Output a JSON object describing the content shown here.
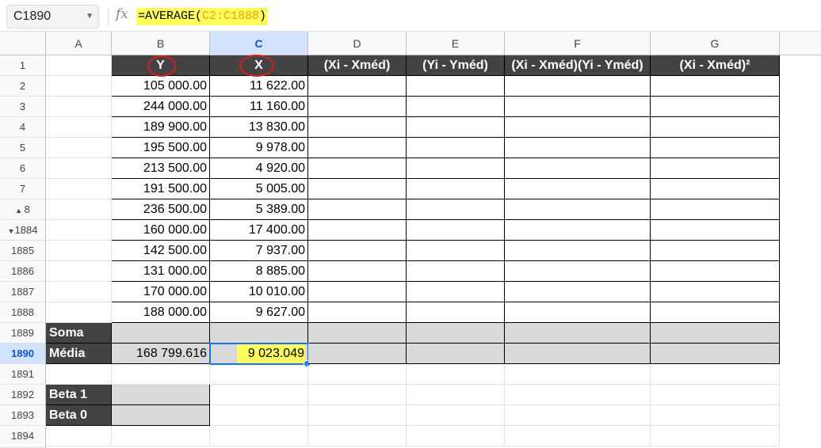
{
  "formula_bar": {
    "name_box": "C1890",
    "fx_label": "fx",
    "formula_prefix": "=AVERAGE(",
    "formula_ref": "C2:C1888",
    "formula_suffix": ")"
  },
  "columns": [
    "A",
    "B",
    "C",
    "D",
    "E",
    "F",
    "G"
  ],
  "selected_column": "C",
  "header_row": {
    "b": "Y",
    "c": "X",
    "d": "(Xi - Xméd)",
    "e": "(Yi - Yméd)",
    "f": "(Xi - Xméd)(Yi - Yméd)",
    "g": "(Xi - Xméd)²"
  },
  "data_rows": [
    {
      "row": "2",
      "y": "105 000.00",
      "x": "11 622.00"
    },
    {
      "row": "3",
      "y": "244 000.00",
      "x": "11 160.00"
    },
    {
      "row": "4",
      "y": "189 900.00",
      "x": "13 830.00"
    },
    {
      "row": "5",
      "y": "195 500.00",
      "x": "9 978.00"
    },
    {
      "row": "6",
      "y": "213 500.00",
      "x": "4 920.00"
    },
    {
      "row": "7",
      "y": "191 500.00",
      "x": "5 005.00"
    },
    {
      "row": "8",
      "y": "236 500.00",
      "x": "5 389.00"
    },
    {
      "row": "1884",
      "y": "160 000.00",
      "x": "17 400.00"
    },
    {
      "row": "1885",
      "y": "142 500.00",
      "x": "7 937.00"
    },
    {
      "row": "1886",
      "y": "131 000.00",
      "x": "8 885.00"
    },
    {
      "row": "1887",
      "y": "170 000.00",
      "x": "10 010.00"
    },
    {
      "row": "1888",
      "y": "188 000.00",
      "x": "9 627.00"
    }
  ],
  "rows": {
    "r1": "1",
    "r1889": "1889",
    "r1890": "1890",
    "r1891": "1891",
    "r1892": "1892",
    "r1893": "1893",
    "r1894": "1894"
  },
  "soma_label": "Soma",
  "media": {
    "label": "Média",
    "y": "168 799.616",
    "x": "9 023.049"
  },
  "beta1_label": "Beta 1",
  "beta0_label": "Beta 0",
  "colors": {
    "header_dark": "#434343",
    "highlight_yellow": "#fdfd5e",
    "selection_blue": "#1a73e8",
    "annotation_red": "#e01b1b"
  }
}
